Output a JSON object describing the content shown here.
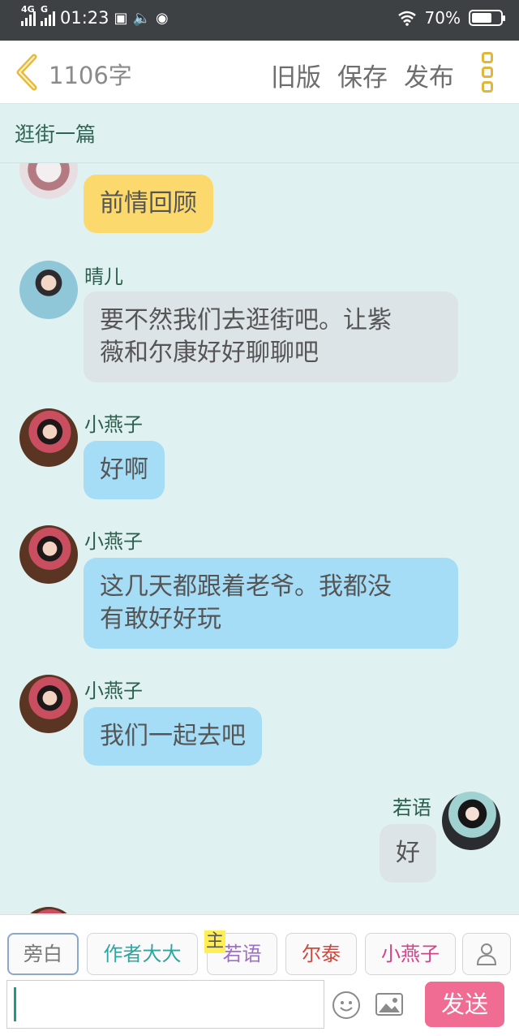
{
  "status_bar": {
    "network1": "4G",
    "network2": "G",
    "time": "01:23",
    "battery_text": "70%",
    "battery_level": 0.7
  },
  "top_bar": {
    "word_count": "1106字",
    "old_version": "旧版",
    "save": "保存",
    "publish": "发布"
  },
  "doc_title": "逛街一篇",
  "messages": [
    {
      "avatar": "avatar-top",
      "text": "前情回顾",
      "style": "yellow"
    },
    {
      "name": "晴儿",
      "text_line1": "要不然我们去逛街吧。让紫",
      "text_line2": "薇和尔康好好聊聊吧",
      "style": "grey"
    },
    {
      "name": "小燕子",
      "text": "好啊",
      "style": "blue"
    },
    {
      "name": "小燕子",
      "text_line1": "这几天都跟着老爷。我都没",
      "text_line2": "有敢好好玩",
      "style": "blue"
    },
    {
      "name": "小燕子",
      "text": "我们一起去吧",
      "style": "blue"
    },
    {
      "name": "若语",
      "text": "好",
      "style": "grey",
      "side": "right"
    }
  ],
  "roles": {
    "narrator": "旁白",
    "author": "作者大大",
    "main_badge": "主",
    "ruoyu": "若语",
    "ertai": "尔泰",
    "xiaoyanzi": "小燕子"
  },
  "composer": {
    "send": "发送"
  },
  "colors": {
    "accent_send": "#f06c92",
    "bubble_blue": "#a6ddf6",
    "bubble_grey": "#dde4e8",
    "bubble_yellow": "#fbd96c",
    "background": "#dff1f0",
    "ertai": "#d2473c",
    "xiaoyanzi": "#d2438a",
    "author": "#2ba6a0",
    "ruoyu": "#9d6fc5"
  }
}
